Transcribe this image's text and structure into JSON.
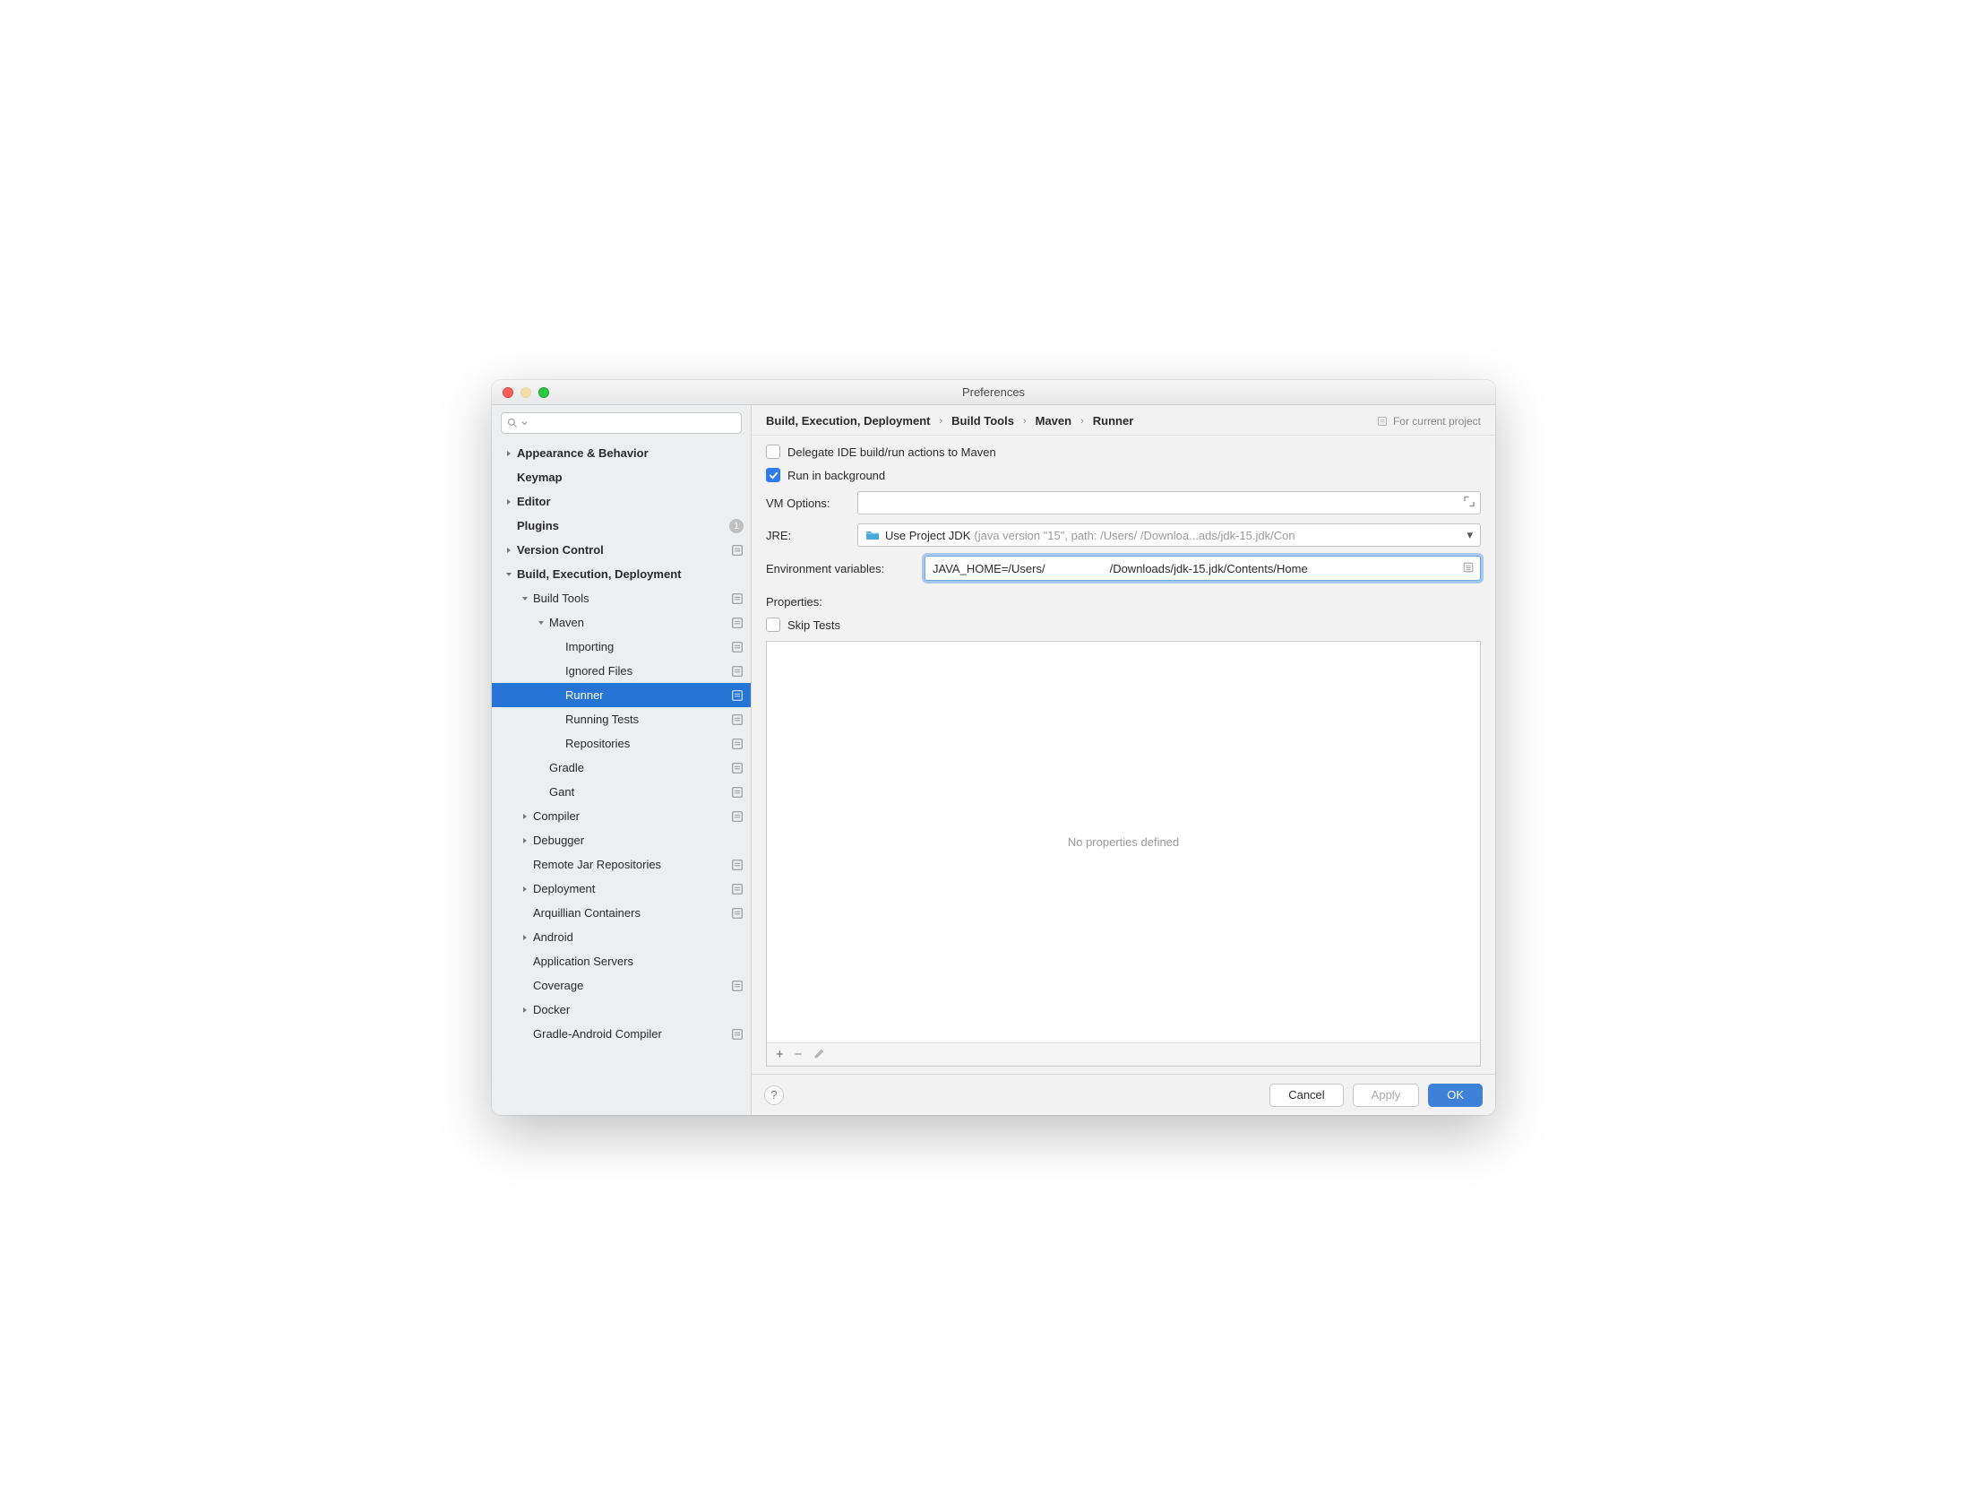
{
  "window": {
    "title": "Preferences"
  },
  "sidebar": {
    "search_placeholder": "",
    "items": [
      {
        "label": "Appearance & Behavior",
        "indent": 0,
        "arrow": "right",
        "bold": true
      },
      {
        "label": "Keymap",
        "indent": 0,
        "arrow": "none",
        "bold": true
      },
      {
        "label": "Editor",
        "indent": 0,
        "arrow": "right",
        "bold": true
      },
      {
        "label": "Plugins",
        "indent": 0,
        "arrow": "none",
        "bold": true,
        "badge": "1"
      },
      {
        "label": "Version Control",
        "indent": 0,
        "arrow": "right",
        "bold": true,
        "proj": true
      },
      {
        "label": "Build, Execution, Deployment",
        "indent": 0,
        "arrow": "down",
        "bold": true
      },
      {
        "label": "Build Tools",
        "indent": 1,
        "arrow": "down",
        "proj": true
      },
      {
        "label": "Maven",
        "indent": 2,
        "arrow": "down",
        "proj": true
      },
      {
        "label": "Importing",
        "indent": 3,
        "arrow": "none",
        "proj": true
      },
      {
        "label": "Ignored Files",
        "indent": 3,
        "arrow": "none",
        "proj": true
      },
      {
        "label": "Runner",
        "indent": 3,
        "arrow": "none",
        "proj": true,
        "selected": true
      },
      {
        "label": "Running Tests",
        "indent": 3,
        "arrow": "none",
        "proj": true
      },
      {
        "label": "Repositories",
        "indent": 3,
        "arrow": "none",
        "proj": true
      },
      {
        "label": "Gradle",
        "indent": 2,
        "arrow": "none",
        "proj": true
      },
      {
        "label": "Gant",
        "indent": 2,
        "arrow": "none",
        "proj": true
      },
      {
        "label": "Compiler",
        "indent": 1,
        "arrow": "right",
        "proj": true
      },
      {
        "label": "Debugger",
        "indent": 1,
        "arrow": "right"
      },
      {
        "label": "Remote Jar Repositories",
        "indent": 1,
        "arrow": "none",
        "proj": true
      },
      {
        "label": "Deployment",
        "indent": 1,
        "arrow": "right",
        "proj": true
      },
      {
        "label": "Arquillian Containers",
        "indent": 1,
        "arrow": "none",
        "proj": true
      },
      {
        "label": "Android",
        "indent": 1,
        "arrow": "right"
      },
      {
        "label": "Application Servers",
        "indent": 1,
        "arrow": "none"
      },
      {
        "label": "Coverage",
        "indent": 1,
        "arrow": "none",
        "proj": true
      },
      {
        "label": "Docker",
        "indent": 1,
        "arrow": "right"
      },
      {
        "label": "Gradle-Android Compiler",
        "indent": 1,
        "arrow": "none",
        "proj": true
      }
    ]
  },
  "breadcrumb": {
    "parts": [
      "Build, Execution, Deployment",
      "Build Tools",
      "Maven",
      "Runner"
    ],
    "scope": "For current project"
  },
  "form": {
    "delegate_label": "Delegate IDE build/run actions to Maven",
    "delegate_checked": false,
    "run_bg_label": "Run in background",
    "run_bg_checked": true,
    "vm_label": "VM Options:",
    "vm_value": "",
    "jre_label": "JRE:",
    "jre_main": "Use Project JDK",
    "jre_secondary": "(java version \"15\", path: /Users/            /Downloa...ads/jdk-15.jdk/Con",
    "env_label": "Environment variables:",
    "env_prefix": "JAVA_HOME=/Users/",
    "env_suffix": "/Downloads/jdk-15.jdk/Contents/Home",
    "props_label": "Properties:",
    "skip_tests_label": "Skip Tests",
    "skip_tests_checked": false,
    "props_empty": "No properties defined"
  },
  "footer": {
    "cancel": "Cancel",
    "apply": "Apply",
    "ok": "OK"
  }
}
